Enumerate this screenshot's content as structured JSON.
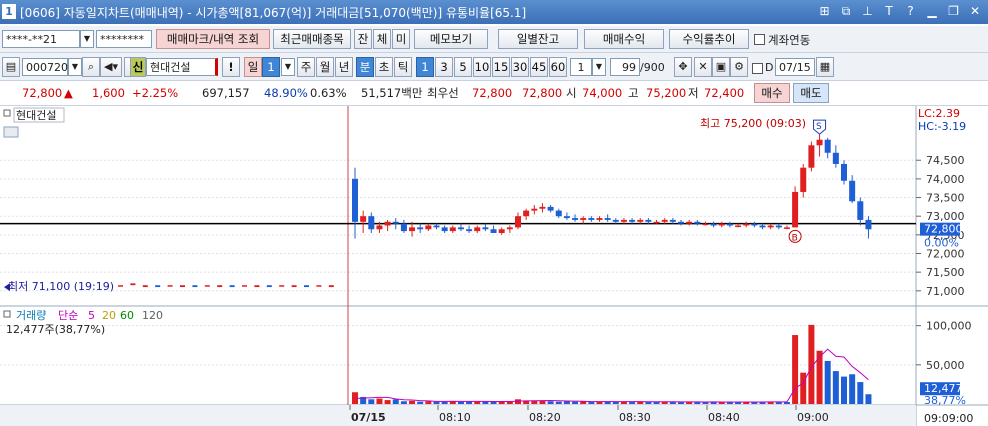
{
  "window": {
    "number": "1",
    "title": "[0606] 자동일지차트(매매내역) - 시가총액[81,067(억)] 거래대금[51,070(백만)] 유통비율[65.1]"
  },
  "toolbar1": {
    "account": "****-**21",
    "password": "********",
    "btn_mark": "매매마크/내역 조회",
    "btn_recent": "최근매매종목",
    "btn_jan": "잔",
    "btn_che": "체",
    "btn_mi": "미",
    "btn_memo": "메모보기",
    "btn_daily": "일별잔고",
    "btn_profit": "매매수익",
    "btn_yield": "수익률추이",
    "link_label": "계좌연동"
  },
  "toolbar2": {
    "code": "000720",
    "shin": "신",
    "stock_name": "현대건설",
    "warn": "!",
    "period_il": "일",
    "period_num": "1",
    "periods": [
      "주",
      "월",
      "년",
      "분",
      "초",
      "틱"
    ],
    "intervals": [
      "1",
      "3",
      "5",
      "10",
      "15",
      "30",
      "45",
      "60"
    ],
    "count_input": "1",
    "view_count": "99",
    "view_total": "/900",
    "date_check": "D",
    "date": "07/15"
  },
  "quote": {
    "price": "72,800",
    "arrow": "▲",
    "change": "1,600",
    "pct": "+2.25%",
    "volume": "697,157",
    "vol_ratio": "48.90%",
    "turnover": "0.63%",
    "amount": "51,517백만",
    "best_label": "최우선",
    "best_ask": "72,800",
    "best_bid": "72,800",
    "open_label": "시",
    "open": "74,000",
    "high_label": "고",
    "high": "75,200",
    "low_label": "저",
    "low": "72,400",
    "buy_btn": "매수",
    "sell_btn": "매도"
  },
  "chart_data": [
    {
      "type": "candlestick",
      "title": "현대건설",
      "annotations": {
        "high": "최고 75,200 (09:03)",
        "low": "최저 71,100 (19:19)",
        "lc": "LC:2.39",
        "hc": "HC:-3.19",
        "buy_mark": "B",
        "sell_mark": "S"
      },
      "ylim": [
        70700,
        75900
      ],
      "yticks": [
        71000,
        71500,
        72000,
        72500,
        73000,
        73500,
        74000,
        74500
      ],
      "ytick_labels": [
        "71,000",
        "71,500",
        "72,000",
        "72,500",
        "73,000",
        "73,500",
        "74,000",
        "74,500"
      ],
      "current_label": "72,800",
      "current_pct": "0.00%",
      "ref_line": 72800,
      "x_labels": [
        "07/15",
        "08:10",
        "08:20",
        "08:30",
        "08:40",
        "09:00"
      ],
      "time_label": "09:09:00",
      "candles": [
        [
          74000,
          74300,
          72400,
          72850
        ],
        [
          72850,
          73150,
          72550,
          73000
        ],
        [
          73000,
          73100,
          72550,
          72650
        ],
        [
          72650,
          72850,
          72550,
          72750
        ],
        [
          72750,
          72900,
          72600,
          72850
        ],
        [
          72850,
          72950,
          72650,
          72800
        ],
        [
          72800,
          72900,
          72550,
          72600
        ],
        [
          72600,
          72850,
          72450,
          72700
        ],
        [
          72700,
          72800,
          72550,
          72650
        ],
        [
          72650,
          72800,
          72600,
          72750
        ],
        [
          72750,
          72800,
          72650,
          72700
        ],
        [
          72700,
          72750,
          72550,
          72600
        ],
        [
          72600,
          72750,
          72550,
          72700
        ],
        [
          72700,
          72800,
          72600,
          72650
        ],
        [
          72650,
          72750,
          72550,
          72600
        ],
        [
          72600,
          72750,
          72550,
          72700
        ],
        [
          72700,
          72800,
          72600,
          72650
        ],
        [
          72650,
          72750,
          72550,
          72550
        ],
        [
          72550,
          72700,
          72500,
          72650
        ],
        [
          72650,
          72750,
          72550,
          72700
        ],
        [
          72700,
          73100,
          72650,
          73000
        ],
        [
          73000,
          73200,
          72900,
          73150
        ],
        [
          73150,
          73300,
          73050,
          73200
        ],
        [
          73200,
          73350,
          73100,
          73250
        ],
        [
          73250,
          73300,
          73100,
          73150
        ],
        [
          73150,
          73200,
          72950,
          73000
        ],
        [
          73000,
          73100,
          72900,
          72950
        ],
        [
          72950,
          73050,
          72850,
          72900
        ],
        [
          72900,
          73000,
          72800,
          72950
        ],
        [
          72950,
          73000,
          72850,
          72900
        ],
        [
          72900,
          73000,
          72850,
          72950
        ],
        [
          72950,
          73050,
          72850,
          72900
        ],
        [
          72900,
          72950,
          72800,
          72850
        ],
        [
          72850,
          72950,
          72800,
          72900
        ],
        [
          72900,
          72950,
          72800,
          72850
        ],
        [
          72850,
          72950,
          72800,
          72900
        ],
        [
          72900,
          72950,
          72800,
          72850
        ],
        [
          72850,
          72900,
          72800,
          72850
        ],
        [
          72850,
          72950,
          72800,
          72900
        ],
        [
          72900,
          72950,
          72800,
          72850
        ],
        [
          72850,
          72900,
          72750,
          72800
        ],
        [
          72800,
          72900,
          72750,
          72850
        ],
        [
          72850,
          72900,
          72750,
          72800
        ],
        [
          72800,
          72850,
          72750,
          72800
        ],
        [
          72800,
          72850,
          72700,
          72750
        ],
        [
          72750,
          72850,
          72700,
          72800
        ],
        [
          72800,
          72850,
          72700,
          72750
        ],
        [
          72750,
          72800,
          72700,
          72750
        ],
        [
          72750,
          72850,
          72700,
          72800
        ],
        [
          72800,
          72850,
          72700,
          72750
        ],
        [
          72750,
          72800,
          72650,
          72700
        ],
        [
          72700,
          72800,
          72650,
          72750
        ],
        [
          72750,
          72800,
          72650,
          72700
        ],
        [
          72700,
          72750,
          72650,
          72700
        ],
        [
          72700,
          73800,
          72700,
          73650
        ],
        [
          73650,
          74400,
          73500,
          74300
        ],
        [
          74300,
          75000,
          74200,
          74900
        ],
        [
          74900,
          75200,
          74600,
          75050
        ],
        [
          75050,
          75100,
          74550,
          74700
        ],
        [
          74700,
          74900,
          74300,
          74400
        ],
        [
          74400,
          74500,
          73850,
          73950
        ],
        [
          73950,
          74100,
          73350,
          73400
        ],
        [
          73400,
          73500,
          72750,
          72900
        ],
        [
          72900,
          73000,
          72400,
          72650
        ]
      ],
      "lower_left": [
        [
          71150,
          71150
        ],
        [
          71150,
          71200
        ],
        [
          71100,
          71150
        ],
        [
          71150,
          71100
        ],
        [
          71150,
          71150
        ],
        [
          71100,
          71150
        ],
        [
          71150,
          71100
        ],
        [
          71150,
          71150
        ],
        [
          71100,
          71150
        ],
        [
          71150,
          71100
        ],
        [
          71150,
          71150
        ],
        [
          71100,
          71150
        ],
        [
          71150,
          71100
        ],
        [
          71150,
          71150
        ],
        [
          71100,
          71150
        ],
        [
          71150,
          71100
        ],
        [
          71150,
          71150
        ],
        [
          71100,
          71150
        ]
      ]
    },
    {
      "type": "bar",
      "title": "거래량",
      "legend": {
        "ma_label": "단순",
        "ma": [
          "5",
          "20",
          "60",
          "120"
        ],
        "ma_colors": [
          "#c000c0",
          "#b8a000",
          "#008a00",
          "#606060"
        ]
      },
      "value_text": "12,477주(38,77%)",
      "ylim": [
        0,
        120000
      ],
      "yticks": [
        50000,
        100000
      ],
      "ytick_labels": [
        "50,000",
        "100,000"
      ],
      "current_label": "12,477",
      "current_pct": "38,77%",
      "values": [
        15000,
        9000,
        6000,
        7000,
        5000,
        6000,
        3500,
        4000,
        3000,
        3500,
        3000,
        3000,
        4000,
        3000,
        3500,
        3000,
        3000,
        3500,
        3500,
        3000,
        6000,
        4500,
        4000,
        4500,
        3500,
        3000,
        3500,
        3000,
        3500,
        2500,
        3000,
        3500,
        3000,
        3000,
        2500,
        3000,
        2500,
        3000,
        3000,
        2500,
        2500,
        3000,
        2500,
        2500,
        3000,
        2500,
        2500,
        2500,
        3000,
        2500,
        3000,
        2500,
        3000,
        2500,
        88000,
        40000,
        101000,
        68000,
        55000,
        42000,
        35000,
        38000,
        28000,
        12477
      ],
      "up": [
        true,
        false,
        false,
        true,
        true,
        false,
        false,
        true,
        false,
        true,
        false,
        false,
        true,
        false,
        false,
        true,
        false,
        false,
        true,
        true,
        true,
        true,
        true,
        true,
        false,
        false,
        false,
        false,
        true,
        false,
        true,
        false,
        false,
        true,
        false,
        true,
        false,
        false,
        true,
        false,
        false,
        true,
        false,
        false,
        false,
        true,
        false,
        false,
        true,
        false,
        false,
        true,
        false,
        false,
        true,
        true,
        true,
        true,
        false,
        false,
        false,
        false,
        false,
        false
      ],
      "ma5": [
        7000,
        7500,
        8000,
        8400,
        8400,
        6600,
        5500,
        5100,
        4300,
        4000,
        3400,
        3300,
        3300,
        3300,
        3300,
        3300,
        3300,
        3200,
        3200,
        3200,
        3600,
        4000,
        4200,
        4300,
        4500,
        4100,
        3800,
        3700,
        3500,
        3100,
        3100,
        3100,
        3100,
        3100,
        3000,
        3000,
        2900,
        2800,
        2800,
        2800,
        2700,
        2700,
        2700,
        2600,
        2700,
        2600,
        2600,
        2600,
        2600,
        2600,
        2600,
        2700,
        2700,
        2700,
        19800,
        27000,
        47000,
        60000,
        70000,
        61000,
        60000,
        48000,
        40000,
        31000
      ]
    }
  ]
}
